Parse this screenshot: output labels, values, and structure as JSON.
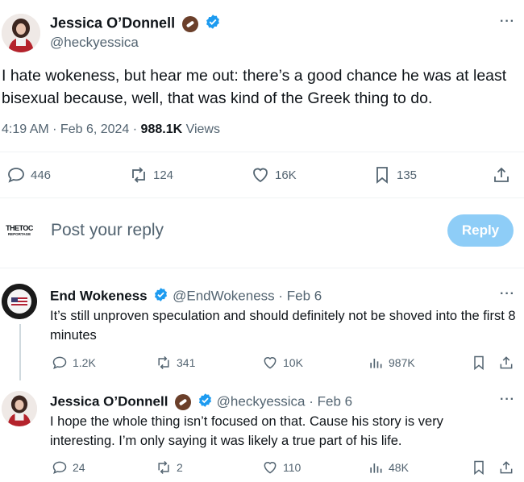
{
  "main_tweet": {
    "author_name": "Jessica O’Donnell",
    "handle": "@heckyessica",
    "text": "I hate wokeness, but hear me out: there’s a good chance he was at least bisexual because, well, that was kind of the Greek thing to do.",
    "time": "4:19 AM · Feb 6, 2024 ·",
    "views_count": "988.1K",
    "views_label": "Views",
    "replies": "446",
    "retweets": "124",
    "likes": "16K",
    "bookmarks": "135"
  },
  "composer": {
    "avatar_text_top": "THETOC",
    "avatar_text_bottom": "REPORTAGE",
    "placeholder": "Post your reply",
    "reply_label": "Reply"
  },
  "replies": [
    {
      "author_name": "End Wokeness",
      "handle": "@EndWokeness",
      "date": "· Feb 6",
      "text": "It’s still unproven speculation and should definitely not be shoved into the first 8 minutes",
      "replies": "1.2K",
      "retweets": "341",
      "likes": "10K",
      "views": "987K"
    },
    {
      "author_name": "Jessica O’Donnell",
      "handle": "@heckyessica",
      "date": "· Feb 6",
      "text": "I hope the whole thing isn’t focused on that. Cause his story is very interesting. I’m only saying it was likely a true part of his life.",
      "replies": "24",
      "retweets": "2",
      "likes": "110",
      "views": "48K"
    }
  ],
  "more_label": "···",
  "colors": {
    "accent": "#1d9bf0",
    "muted": "#536471",
    "reply_button": "#8ecdf7"
  }
}
